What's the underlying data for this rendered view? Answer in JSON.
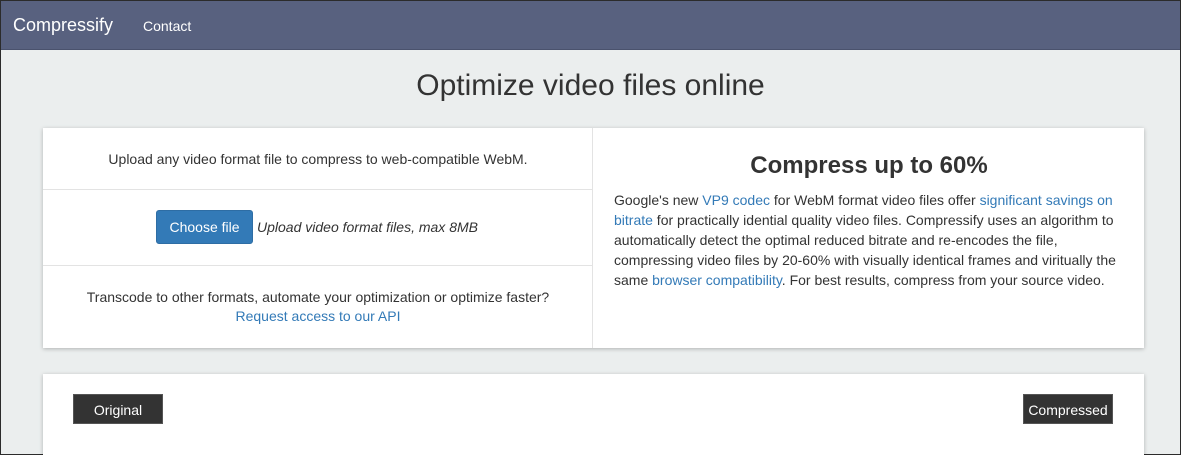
{
  "navbar": {
    "brand": "Compressify",
    "links": [
      "Contact"
    ]
  },
  "page_title": "Optimize video files online",
  "upload": {
    "intro": "Upload any video format file to compress to web-compatible WebM.",
    "choose_button": "Choose file",
    "hint": "Upload video format files, max 8MB",
    "api_text": "Transcode to other formats, automate your optimization or optimize faster?",
    "api_link": "Request access to our API"
  },
  "info": {
    "heading": "Compress up to 60%",
    "p1": "Google's new ",
    "link_vp9": "VP9 codec",
    "p2": " for WebM format video files offer ",
    "link_savings": "significant savings on bitrate",
    "p3": " for practically idential quality video files. Compressify uses an algorithm to automatically detect the optimal reduced bitrate and re-encodes the file, compressing video files by 20-60% with visually identical frames and viritually the same ",
    "link_compat": "browser compatibility",
    "p4": ". For best results, compress from your source video."
  },
  "compare": {
    "original_label": "Original",
    "compressed_label": "Compressed"
  },
  "colors": {
    "navbar_bg": "#58617f",
    "page_bg": "#ebeeee",
    "link": "#337ab7",
    "primary_button": "#337ab7",
    "tag_bg": "#333333"
  }
}
